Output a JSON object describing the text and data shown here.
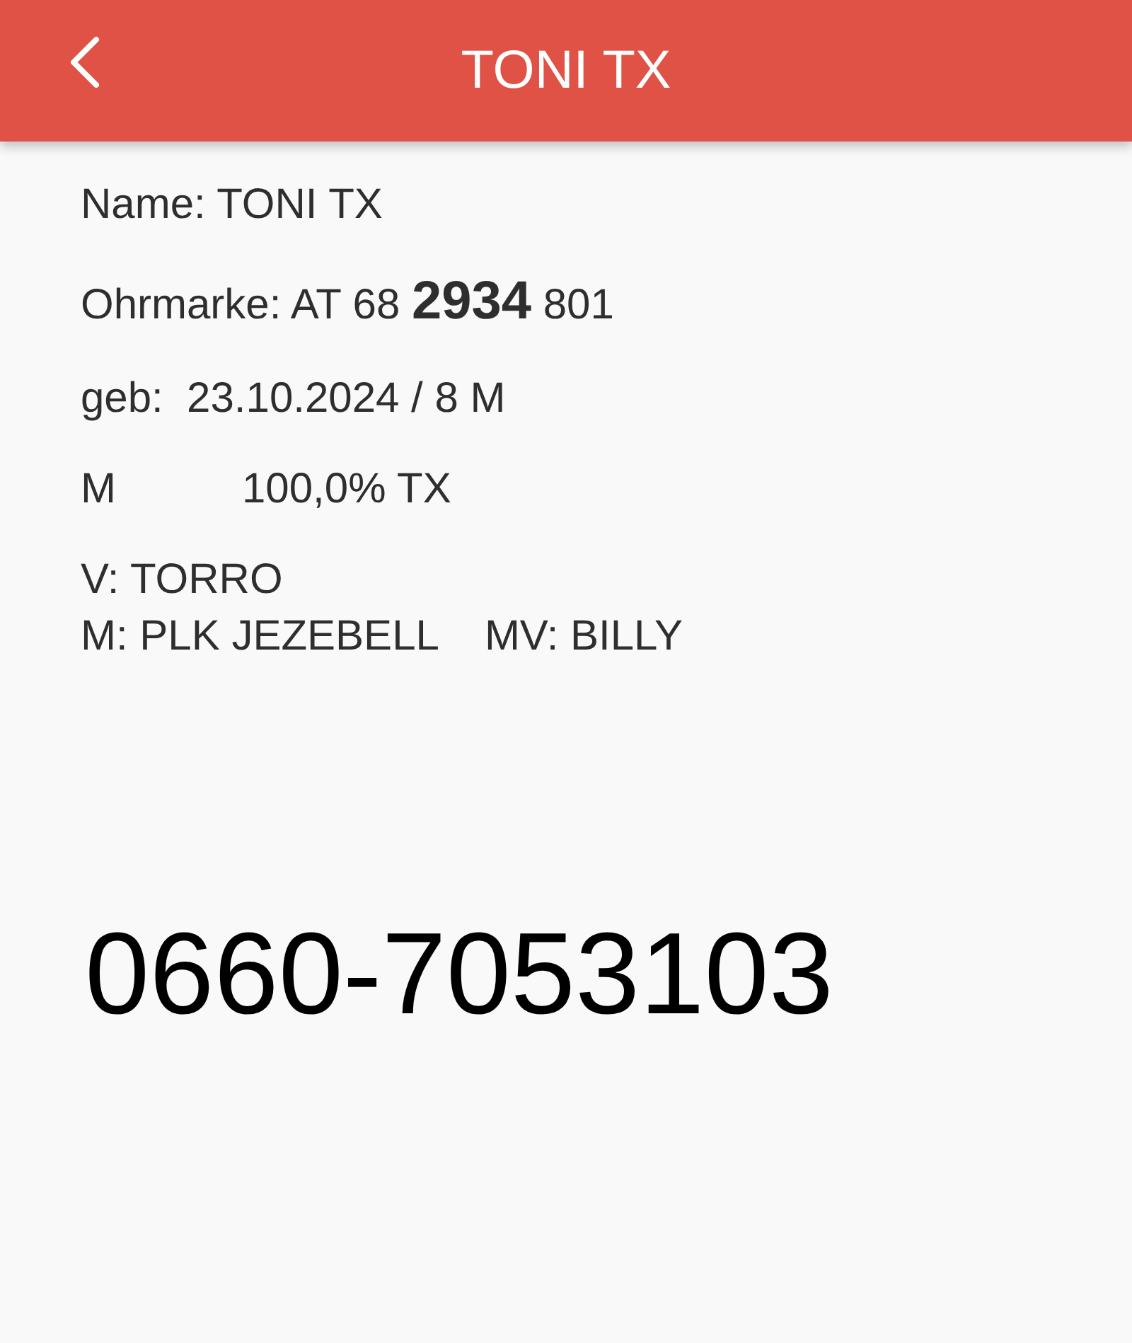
{
  "header": {
    "title": "TONI TX"
  },
  "details": {
    "name": "Name: TONI TX",
    "ear_tag": "Ohrmarke: AT 68 **2934** 801",
    "birth": "geb:  23.10.2024 / 8 M",
    "sex": "M",
    "breed": "100,0% TX",
    "sire": "V: TORRO",
    "dam": "M: PLK JEZEBELL",
    "dam_sire": "MV: BILLY"
  },
  "phone": "0660-7053103"
}
